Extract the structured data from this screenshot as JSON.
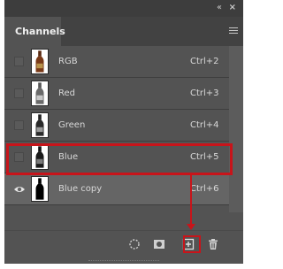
{
  "panel": {
    "tab_label": "Channels",
    "collapse_glyph": "‹‹",
    "close_glyph": "×"
  },
  "channels": [
    {
      "name": "RGB",
      "shortcut": "Ctrl+2",
      "visible": false,
      "selected": false
    },
    {
      "name": "Red",
      "shortcut": "Ctrl+3",
      "visible": false,
      "selected": false
    },
    {
      "name": "Green",
      "shortcut": "Ctrl+4",
      "visible": false,
      "selected": false
    },
    {
      "name": "Blue",
      "shortcut": "Ctrl+5",
      "visible": false,
      "selected": false
    },
    {
      "name": "Blue copy",
      "shortcut": "Ctrl+6",
      "visible": true,
      "selected": true
    }
  ],
  "bottom_icons": [
    "load-selection-icon",
    "save-selection-mask-icon",
    "new-channel-icon",
    "delete-channel-icon"
  ],
  "colors": {
    "highlight": "#c8141a",
    "panel_bg": "#535353",
    "selected_row": "#656565"
  }
}
